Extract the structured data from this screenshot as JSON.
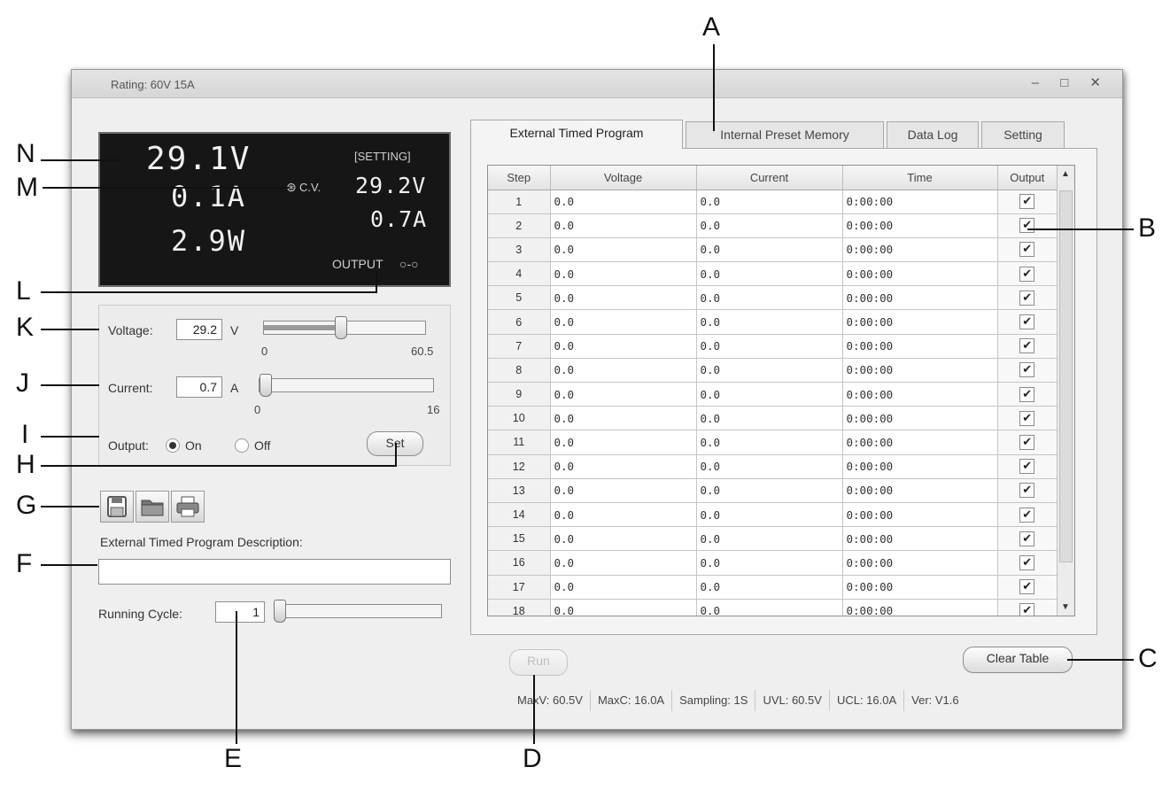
{
  "window": {
    "title": "Rating: 60V 15A",
    "controls": [
      "–",
      "□",
      "✕"
    ]
  },
  "display": {
    "voltage": "29.1V",
    "current": "0.1A",
    "power": "2.9W",
    "setting_label": "[SETTING]",
    "mode": "C.V.",
    "set_voltage": "29.2V",
    "set_current": "0.7A",
    "output_label": "OUTPUT",
    "output_symbol": "○-○"
  },
  "controls": {
    "voltage_label": "Voltage:",
    "voltage_value": "29.2",
    "voltage_unit": "V",
    "voltage_min": "0",
    "voltage_max": "60.5",
    "voltage_level": 0.48,
    "current_label": "Current:",
    "current_value": "0.7",
    "current_unit": "A",
    "current_min": "0",
    "current_max": "16",
    "current_level": 0.04,
    "output_label": "Output:",
    "on_label": "On",
    "off_label": "Off",
    "output_selected": "On",
    "set_button": "Set"
  },
  "toolbar": {
    "icons": [
      "save-icon",
      "open-folder-icon",
      "print-icon"
    ]
  },
  "description": {
    "label": "External Timed Program Description:",
    "value": ""
  },
  "running_cycle": {
    "label": "Running Cycle:",
    "value": "1"
  },
  "tabs": [
    "External Timed Program",
    "Internal Preset Memory",
    "Data Log",
    "Setting"
  ],
  "active_tab": "External Timed Program",
  "table": {
    "columns": [
      "Step",
      "Voltage",
      "Current",
      "Time",
      "Output"
    ],
    "rows": [
      [
        "1",
        "0.0",
        "0.0",
        "0:00:00",
        true
      ],
      [
        "2",
        "0.0",
        "0.0",
        "0:00:00",
        true
      ],
      [
        "3",
        "0.0",
        "0.0",
        "0:00:00",
        true
      ],
      [
        "4",
        "0.0",
        "0.0",
        "0:00:00",
        true
      ],
      [
        "5",
        "0.0",
        "0.0",
        "0:00:00",
        true
      ],
      [
        "6",
        "0.0",
        "0.0",
        "0:00:00",
        true
      ],
      [
        "7",
        "0.0",
        "0.0",
        "0:00:00",
        true
      ],
      [
        "8",
        "0.0",
        "0.0",
        "0:00:00",
        true
      ],
      [
        "9",
        "0.0",
        "0.0",
        "0:00:00",
        true
      ],
      [
        "10",
        "0.0",
        "0.0",
        "0:00:00",
        true
      ],
      [
        "11",
        "0.0",
        "0.0",
        "0:00:00",
        true
      ],
      [
        "12",
        "0.0",
        "0.0",
        "0:00:00",
        true
      ],
      [
        "13",
        "0.0",
        "0.0",
        "0:00:00",
        true
      ],
      [
        "14",
        "0.0",
        "0.0",
        "0:00:00",
        true
      ],
      [
        "15",
        "0.0",
        "0.0",
        "0:00:00",
        true
      ],
      [
        "16",
        "0.0",
        "0.0",
        "0:00:00",
        true
      ],
      [
        "17",
        "0.0",
        "0.0",
        "0:00:00",
        true
      ],
      [
        "18",
        "0.0",
        "0.0",
        "0:00:00",
        true
      ]
    ]
  },
  "buttons": {
    "run": "Run",
    "clear_table": "Clear Table"
  },
  "status_bar": [
    "MaxV: 60.5V",
    "MaxC: 16.0A",
    "Sampling: 1S",
    "UVL: 60.5V",
    "UCL: 16.0A",
    "Ver: V1.6"
  ],
  "callouts": [
    "A",
    "B",
    "C",
    "D",
    "E",
    "F",
    "G",
    "H",
    "I",
    "J",
    "K",
    "L",
    "M",
    "N"
  ]
}
